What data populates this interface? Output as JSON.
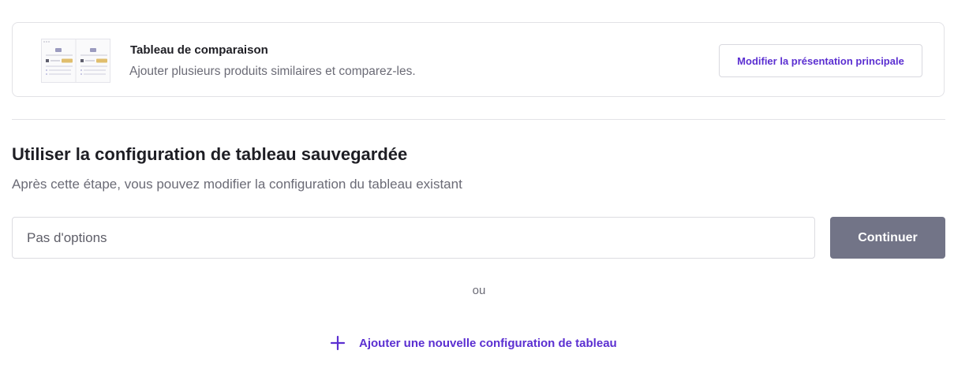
{
  "layout_card": {
    "title": "Tableau de comparaison",
    "description": "Ajouter plusieurs produits similaires et comparez-les.",
    "modify_button_label": "Modifier la présentation principale",
    "thumbnail_icon": "comparison-table-thumbnail"
  },
  "saved_config": {
    "title": "Utiliser la configuration de tableau sauvegardée",
    "description": "Après cette étape, vous pouvez modifier la configuration du tableau existant",
    "select_value": "Pas d'options",
    "continue_label": "Continuer"
  },
  "separator_text": "ou",
  "add_new": {
    "icon": "plus-icon",
    "label": "Ajouter une nouvelle configuration de tableau"
  },
  "colors": {
    "accent": "#5b2fd1",
    "continue_button": "#727487",
    "border": "#e2e2e6",
    "text_primary": "#1e1e24",
    "text_secondary": "#6b6b76"
  }
}
